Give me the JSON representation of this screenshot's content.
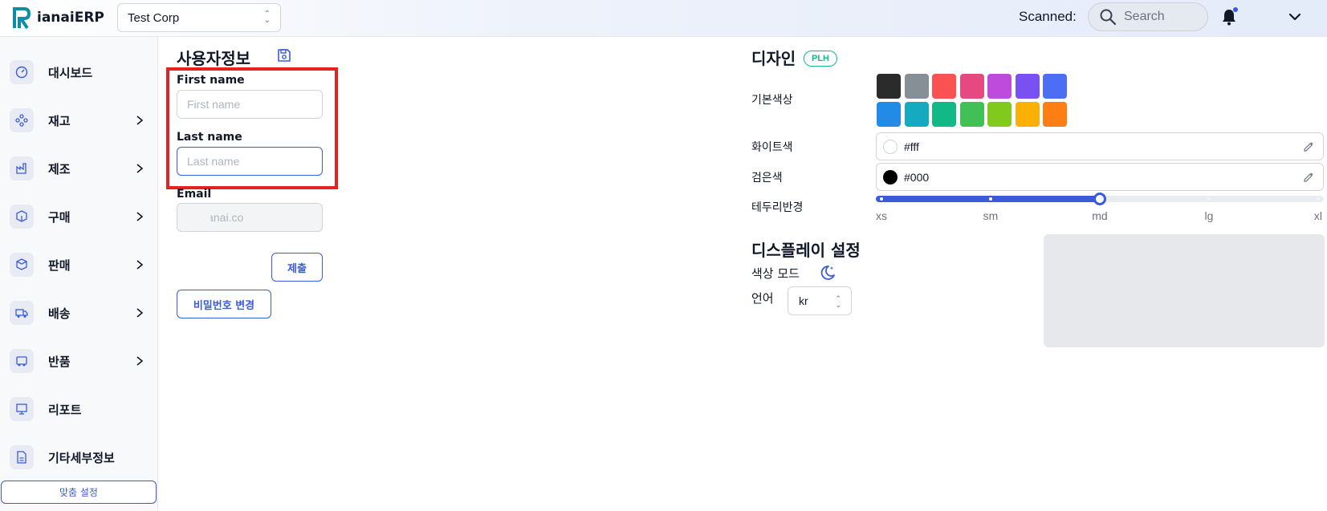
{
  "header": {
    "brand": "ianaiERP",
    "company": "Test Corp",
    "scanned_label": "Scanned:",
    "search_placeholder": "Search"
  },
  "sidebar": {
    "items": [
      {
        "label": "대시보드",
        "icon": "gauge-icon",
        "has_chevron": false
      },
      {
        "label": "재고",
        "icon": "inventory-icon",
        "has_chevron": true
      },
      {
        "label": "제조",
        "icon": "factory-icon",
        "has_chevron": true
      },
      {
        "label": "구매",
        "icon": "purchase-icon",
        "has_chevron": true
      },
      {
        "label": "판매",
        "icon": "sales-icon",
        "has_chevron": true
      },
      {
        "label": "배송",
        "icon": "truck-icon",
        "has_chevron": true
      },
      {
        "label": "반품",
        "icon": "return-icon",
        "has_chevron": true
      },
      {
        "label": "리포트",
        "icon": "report-icon",
        "has_chevron": false
      },
      {
        "label": "기타세부정보",
        "icon": "document-icon",
        "has_chevron": false
      }
    ],
    "custom_settings_label": "맞춤 설정"
  },
  "user_info": {
    "title": "사용자정보",
    "first_name_label": "First name",
    "first_name_placeholder": "First name",
    "last_name_label": "Last name",
    "last_name_placeholder": "Last name",
    "email_label": "Email",
    "email_value": "n@ianai.co",
    "submit_label": "제출",
    "change_password_label": "비밀번호 변경"
  },
  "design": {
    "title": "디자인",
    "badge": "PLH",
    "base_color_label": "기본색상",
    "swatches": [
      "#2b2b2b",
      "#868e96",
      "#fa5252",
      "#e64980",
      "#be4bdb",
      "#7950f2",
      "#4c6ef5",
      "#228be6",
      "#15aabf",
      "#12b886",
      "#40c057",
      "#82c91e",
      "#fab005",
      "#fd7e14"
    ],
    "white_label": "화이트색",
    "white_value": "#fff",
    "black_label": "검은색",
    "black_value": "#000",
    "radius_label": "테두리반경",
    "radius_marks": [
      "xs",
      "sm",
      "md",
      "lg",
      "xl"
    ],
    "radius_selected_index": 2,
    "accent": "#3b5bdb"
  },
  "display": {
    "title": "디스플레이 설정",
    "color_mode_label": "색상 모드",
    "language_label": "언어",
    "language_value": "kr"
  }
}
